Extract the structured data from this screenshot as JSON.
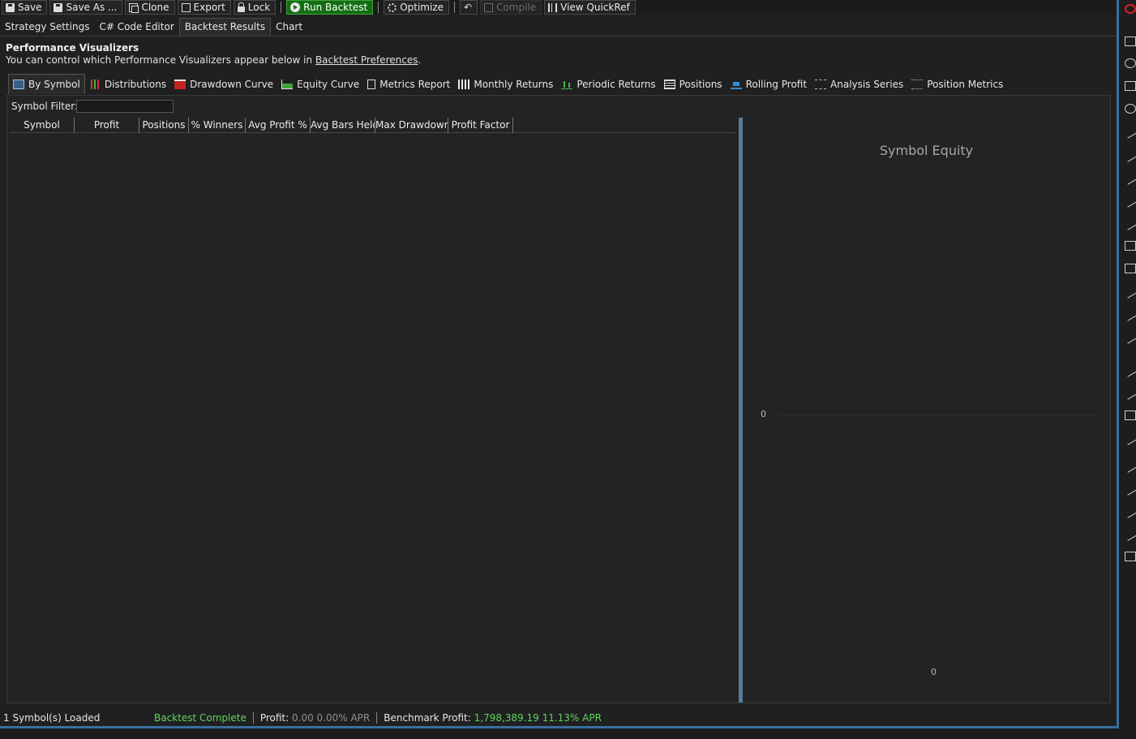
{
  "toolbar": {
    "save": "Save",
    "save_as": "Save As ...",
    "clone": "Clone",
    "export": "Export",
    "lock": "Lock",
    "run_backtest": "Run Backtest",
    "optimize": "Optimize",
    "compile": "Compile",
    "view_quickref": "View QuickRef"
  },
  "main_tabs": [
    "Strategy Settings",
    "C# Code Editor",
    "Backtest Results",
    "Chart"
  ],
  "header": {
    "title": "Performance Visualizers",
    "subtitle_prefix": "You can control which Performance Visualizers appear below in ",
    "subtitle_link": "Backtest Preferences",
    "subtitle_suffix": "."
  },
  "viz_tabs": [
    "By Symbol",
    "Distributions",
    "Drawdown Curve",
    "Equity Curve",
    "Metrics Report",
    "Monthly Returns",
    "Periodic Returns",
    "Positions",
    "Rolling Profit",
    "Analysis Series",
    "Position Metrics"
  ],
  "filter": {
    "label": "Symbol Filter:",
    "value": ""
  },
  "grid": {
    "columns": [
      "Symbol",
      "Profit",
      "Positions",
      "% Winners",
      "Avg Profit %",
      "Avg Bars Held",
      "Max Drawdown",
      "Profit Factor"
    ]
  },
  "chart": {
    "title": "Symbol Equity",
    "y_tick": "0",
    "x_tick": "0"
  },
  "chart_data": {
    "type": "line",
    "title": "Symbol Equity",
    "series": [],
    "yticks": [
      "0"
    ],
    "xticks": [
      "0"
    ]
  },
  "status": {
    "symbols_loaded": "1 Symbol(s) Loaded",
    "backtest_state": "Backtest Complete",
    "profit_label": "Profit:",
    "profit_value": "0.00 0.00% APR",
    "benchmark_label": "Benchmark Profit:",
    "benchmark_value": "1,798,389.19 11.13% APR"
  },
  "colors": {
    "accent_blue": "#3a6fa0",
    "run_green": "#136e13",
    "status_green": "#5fd35f",
    "splitter": "#5b7a98"
  }
}
